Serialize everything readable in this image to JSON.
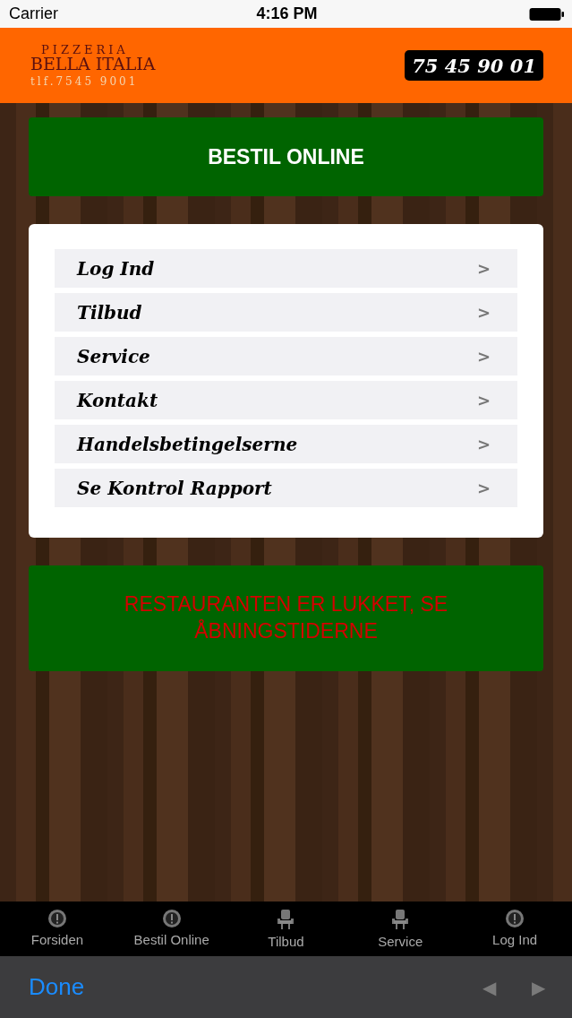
{
  "status_bar": {
    "carrier": "Carrier",
    "time": "4:16 PM"
  },
  "header": {
    "logo": {
      "top": "PIZZERIA",
      "name": "BELLA ITALIA",
      "phone": "tlf.7545 9001"
    },
    "phone_button": "75 45 90 01"
  },
  "order_button": "BESTIL ONLINE",
  "menu": [
    {
      "label": "Log Ind",
      "chevron": ">"
    },
    {
      "label": "Tilbud",
      "chevron": ">"
    },
    {
      "label": "Service",
      "chevron": ">"
    },
    {
      "label": "Kontakt",
      "chevron": ">"
    },
    {
      "label": "Handelsbetingelserne",
      "chevron": ">"
    },
    {
      "label": "Se Kontrol Rapport",
      "chevron": ">"
    }
  ],
  "closed_notice": "RESTAURANTEN ER LUKKET, SE ÅBNINGSTIDERNE",
  "tab_bar": [
    {
      "label": "Forsiden",
      "kind": "badge"
    },
    {
      "label": "Bestil Online",
      "kind": "badge"
    },
    {
      "label": "Tilbud",
      "kind": "chair"
    },
    {
      "label": "Service",
      "kind": "chair"
    },
    {
      "label": "Log Ind",
      "kind": "badge"
    }
  ],
  "toolbar": {
    "done": "Done",
    "back": {
      "glyph": "◀",
      "disabled": true
    },
    "forward": {
      "glyph": "▶",
      "disabled": true
    }
  }
}
